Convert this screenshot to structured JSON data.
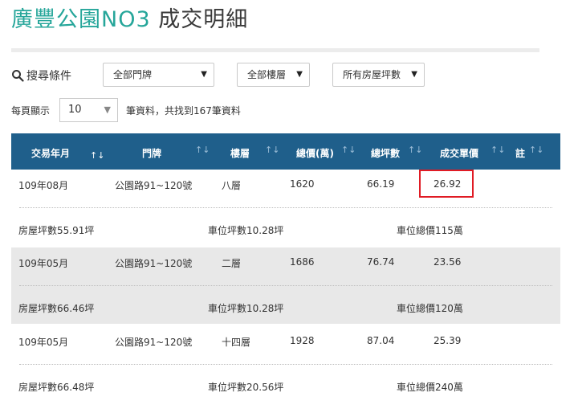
{
  "page": {
    "title_part1": "廣豐公園NO3",
    "title_part2": "成交明細"
  },
  "filters": {
    "label": "搜尋條件",
    "door_select": "全部門牌",
    "floor_select": "全部樓層",
    "area_select": "所有房屋坪數"
  },
  "paging": {
    "per_page_label": "每頁顯示",
    "per_page_value": "10",
    "count_text": "筆資料，共找到167筆資料"
  },
  "table": {
    "headers": [
      "交易年月",
      "門牌",
      "樓層",
      "總價(萬)",
      "總坪數",
      "成交單價",
      "註"
    ],
    "rows": [
      {
        "date": "109年08月",
        "address": "公園路91~120號",
        "floor": "八層",
        "total_price": "1620",
        "total_area": "66.19",
        "unit_price": "26.92",
        "house_area": "房屋坪數55.91坪",
        "parking_area": "車位坪數10.28坪",
        "parking_price": "車位總價115萬"
      },
      {
        "date": "109年05月",
        "address": "公園路91~120號",
        "floor": "二層",
        "total_price": "1686",
        "total_area": "76.74",
        "unit_price": "23.56",
        "house_area": "房屋坪數66.46坪",
        "parking_area": "車位坪數10.28坪",
        "parking_price": "車位總價120萬"
      },
      {
        "date": "109年05月",
        "address": "公園路91~120號",
        "floor": "十四層",
        "total_price": "1928",
        "total_area": "87.04",
        "unit_price": "25.39",
        "house_area": "房屋坪數66.48坪",
        "parking_area": "車位坪數20.56坪",
        "parking_price": "車位總價240萬"
      }
    ]
  },
  "colors": {
    "header_bg": "#1f5f8b",
    "title_accent": "#26a69a",
    "highlight": "#e01b24",
    "row_shade": "#e8e8e8"
  }
}
